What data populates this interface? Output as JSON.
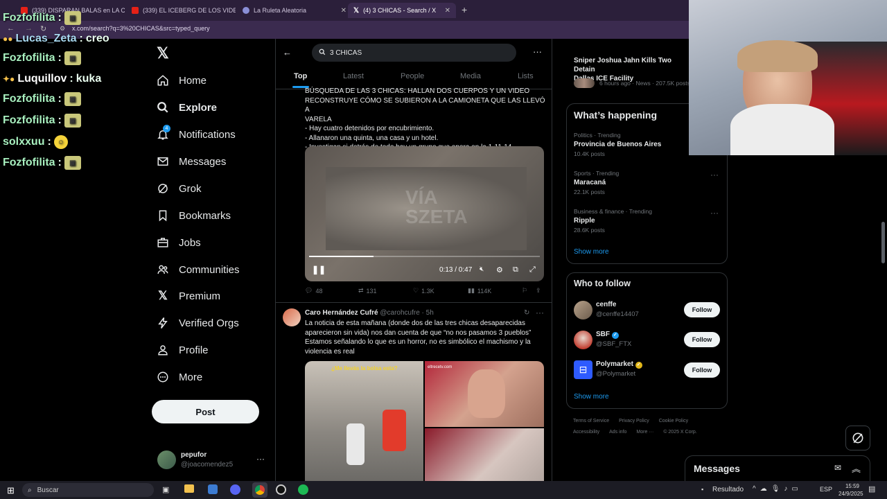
{
  "browser": {
    "tabs": [
      {
        "title": "(339) DISPARAN BALAS en LA C"
      },
      {
        "title": "(339) EL ICEBERG DE LOS VIDEC"
      },
      {
        "title": "La Ruleta Aleatoria"
      },
      {
        "title": "(4) 3 CHICAS - Search / X"
      }
    ],
    "url": "x.com/search?q=3%20CHICAS&src=typed_query"
  },
  "chat": [
    {
      "user": "Fozfofilita",
      "msg": ""
    },
    {
      "user": "Lucas_Zeta",
      "msg": "creo"
    },
    {
      "user": "Fozfofilita",
      "msg": ""
    },
    {
      "user": "Luquillov",
      "msg": "kuka"
    },
    {
      "user": "Fozfofilita",
      "msg": ""
    },
    {
      "user": "Fozfofilita",
      "msg": ""
    },
    {
      "user": "solxxuu",
      "msg": ""
    },
    {
      "user": "Fozfofilita",
      "msg": ""
    }
  ],
  "nav": {
    "items": [
      {
        "label": "Home",
        "icon": "home-icon"
      },
      {
        "label": "Explore",
        "icon": "search-icon"
      },
      {
        "label": "Notifications",
        "icon": "bell-icon",
        "badge": "4"
      },
      {
        "label": "Messages",
        "icon": "mail-icon"
      },
      {
        "label": "Grok",
        "icon": "grok-icon"
      },
      {
        "label": "Bookmarks",
        "icon": "bookmark-icon"
      },
      {
        "label": "Jobs",
        "icon": "briefcase-icon"
      },
      {
        "label": "Communities",
        "icon": "people-icon"
      },
      {
        "label": "Premium",
        "icon": "x-logo-icon"
      },
      {
        "label": "Verified Orgs",
        "icon": "lightning-icon"
      },
      {
        "label": "Profile",
        "icon": "person-icon"
      },
      {
        "label": "More",
        "icon": "more-circle-icon"
      }
    ],
    "post_label": "Post",
    "account": {
      "name": "pepufor",
      "handle": "@joacomendez5"
    }
  },
  "search": {
    "query": "3 CHICAS",
    "tabs": [
      "Top",
      "Latest",
      "People",
      "Media",
      "Lists"
    ]
  },
  "tweet1": {
    "text_line1": "BÚSQUEDA DE LAS 3 CHICAS: HALLAN DOS CUERPOS Y UN VIDEO",
    "text_line2": "RECONSTRUYE CÓMO SE SUBIERON A LA CAMIONETA QUE LAS LLEVÓ A",
    "text_line3": "VARELA",
    "bullet1": "- Hay cuatro detenidos por encubrimiento.",
    "bullet2": "- Allanaron una quinta, una casa y un hotel.",
    "bullet3": "- Investigan si detrás de todo hay un grupo que opera en la 1-11-14",
    "video_time": "0:13 / 0:47",
    "watermark": "VÍA SZETA",
    "replies": "48",
    "reposts": "131",
    "likes": "1.3K",
    "views": "114K"
  },
  "tweet2": {
    "author": "Caro Hernández Cufré",
    "handle": "@carohcufre",
    "time": "· 5h",
    "text_line1": "La noticia de esta mañana (donde dos de las tres chicas desaparecidas",
    "text_line2": "aparecieron sin vida) nos dan cuenta de que “no nos pasamos 3 pueblos”",
    "text_line3": "Estamos señalando lo que es un horror, no es simbólico el machismo y la",
    "text_line4": "violencia es real",
    "img_caption": "¿Me llevás la bolsa esta?",
    "img_tag": "eltrecetv.com"
  },
  "sidebar": {
    "top_story": {
      "title_line1": "Sniper Joshua Jahn Kills Two Detain",
      "title_line2": "Dallas ICE Facility",
      "meta": "6 hours ago · News · 207.5K posts"
    },
    "happening_title": "What’s happening",
    "trends": [
      {
        "meta": "Politics · Trending",
        "name": "Provincia de Buenos Aires",
        "posts": "10.4K posts"
      },
      {
        "meta": "Sports · Trending",
        "name": "Maracaná",
        "posts": "22.1K posts"
      },
      {
        "meta": "Business & finance · Trending",
        "name": "Ripple",
        "posts": "28.6K posts"
      }
    ],
    "show_more": "Show more",
    "wtf_title": "Who to follow",
    "who_to_follow": [
      {
        "name": "cenffe",
        "handle": "@cenffe14407",
        "button": "Follow"
      },
      {
        "name": "SBF",
        "handle": "@SBF_FTX",
        "button": "Follow"
      },
      {
        "name": "Polymarket",
        "handle": "@Polymarket",
        "button": "Follow"
      }
    ],
    "footer_line1": [
      "Terms of Service",
      "Privacy Policy",
      "Cookie Policy"
    ],
    "footer_line2": [
      "Accessibility",
      "Ads info",
      "More ···",
      "© 2025 X Corp."
    ]
  },
  "messages_drawer": {
    "title": "Messages"
  },
  "taskbar": {
    "search_label": "Buscar",
    "weather": "Resultado",
    "lang": "ESP",
    "time": "15:59",
    "date": "24/9/2025"
  },
  "colors": {
    "accent": "#1d9bf0",
    "verified_gold": "#e2b719"
  }
}
